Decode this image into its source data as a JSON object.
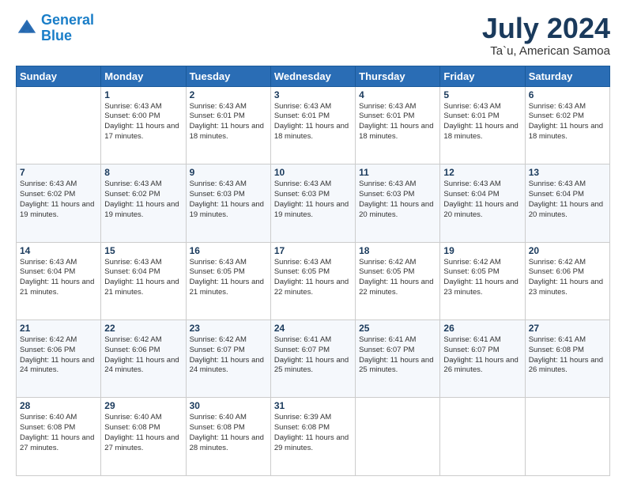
{
  "header": {
    "logo_line1": "General",
    "logo_line2": "Blue",
    "month_title": "July 2024",
    "location": "Ta`u, American Samoa"
  },
  "days_of_week": [
    "Sunday",
    "Monday",
    "Tuesday",
    "Wednesday",
    "Thursday",
    "Friday",
    "Saturday"
  ],
  "weeks": [
    [
      {
        "day": "",
        "sunrise": "",
        "sunset": "",
        "daylight": ""
      },
      {
        "day": "1",
        "sunrise": "6:43 AM",
        "sunset": "6:00 PM",
        "daylight": "11 hours and 17 minutes."
      },
      {
        "day": "2",
        "sunrise": "6:43 AM",
        "sunset": "6:01 PM",
        "daylight": "11 hours and 18 minutes."
      },
      {
        "day": "3",
        "sunrise": "6:43 AM",
        "sunset": "6:01 PM",
        "daylight": "11 hours and 18 minutes."
      },
      {
        "day": "4",
        "sunrise": "6:43 AM",
        "sunset": "6:01 PM",
        "daylight": "11 hours and 18 minutes."
      },
      {
        "day": "5",
        "sunrise": "6:43 AM",
        "sunset": "6:01 PM",
        "daylight": "11 hours and 18 minutes."
      },
      {
        "day": "6",
        "sunrise": "6:43 AM",
        "sunset": "6:02 PM",
        "daylight": "11 hours and 18 minutes."
      }
    ],
    [
      {
        "day": "7",
        "sunrise": "6:43 AM",
        "sunset": "6:02 PM",
        "daylight": "11 hours and 19 minutes."
      },
      {
        "day": "8",
        "sunrise": "6:43 AM",
        "sunset": "6:02 PM",
        "daylight": "11 hours and 19 minutes."
      },
      {
        "day": "9",
        "sunrise": "6:43 AM",
        "sunset": "6:03 PM",
        "daylight": "11 hours and 19 minutes."
      },
      {
        "day": "10",
        "sunrise": "6:43 AM",
        "sunset": "6:03 PM",
        "daylight": "11 hours and 19 minutes."
      },
      {
        "day": "11",
        "sunrise": "6:43 AM",
        "sunset": "6:03 PM",
        "daylight": "11 hours and 20 minutes."
      },
      {
        "day": "12",
        "sunrise": "6:43 AM",
        "sunset": "6:04 PM",
        "daylight": "11 hours and 20 minutes."
      },
      {
        "day": "13",
        "sunrise": "6:43 AM",
        "sunset": "6:04 PM",
        "daylight": "11 hours and 20 minutes."
      }
    ],
    [
      {
        "day": "14",
        "sunrise": "6:43 AM",
        "sunset": "6:04 PM",
        "daylight": "11 hours and 21 minutes."
      },
      {
        "day": "15",
        "sunrise": "6:43 AM",
        "sunset": "6:04 PM",
        "daylight": "11 hours and 21 minutes."
      },
      {
        "day": "16",
        "sunrise": "6:43 AM",
        "sunset": "6:05 PM",
        "daylight": "11 hours and 21 minutes."
      },
      {
        "day": "17",
        "sunrise": "6:43 AM",
        "sunset": "6:05 PM",
        "daylight": "11 hours and 22 minutes."
      },
      {
        "day": "18",
        "sunrise": "6:42 AM",
        "sunset": "6:05 PM",
        "daylight": "11 hours and 22 minutes."
      },
      {
        "day": "19",
        "sunrise": "6:42 AM",
        "sunset": "6:05 PM",
        "daylight": "11 hours and 23 minutes."
      },
      {
        "day": "20",
        "sunrise": "6:42 AM",
        "sunset": "6:06 PM",
        "daylight": "11 hours and 23 minutes."
      }
    ],
    [
      {
        "day": "21",
        "sunrise": "6:42 AM",
        "sunset": "6:06 PM",
        "daylight": "11 hours and 24 minutes."
      },
      {
        "day": "22",
        "sunrise": "6:42 AM",
        "sunset": "6:06 PM",
        "daylight": "11 hours and 24 minutes."
      },
      {
        "day": "23",
        "sunrise": "6:42 AM",
        "sunset": "6:07 PM",
        "daylight": "11 hours and 24 minutes."
      },
      {
        "day": "24",
        "sunrise": "6:41 AM",
        "sunset": "6:07 PM",
        "daylight": "11 hours and 25 minutes."
      },
      {
        "day": "25",
        "sunrise": "6:41 AM",
        "sunset": "6:07 PM",
        "daylight": "11 hours and 25 minutes."
      },
      {
        "day": "26",
        "sunrise": "6:41 AM",
        "sunset": "6:07 PM",
        "daylight": "11 hours and 26 minutes."
      },
      {
        "day": "27",
        "sunrise": "6:41 AM",
        "sunset": "6:08 PM",
        "daylight": "11 hours and 26 minutes."
      }
    ],
    [
      {
        "day": "28",
        "sunrise": "6:40 AM",
        "sunset": "6:08 PM",
        "daylight": "11 hours and 27 minutes."
      },
      {
        "day": "29",
        "sunrise": "6:40 AM",
        "sunset": "6:08 PM",
        "daylight": "11 hours and 27 minutes."
      },
      {
        "day": "30",
        "sunrise": "6:40 AM",
        "sunset": "6:08 PM",
        "daylight": "11 hours and 28 minutes."
      },
      {
        "day": "31",
        "sunrise": "6:39 AM",
        "sunset": "6:08 PM",
        "daylight": "11 hours and 29 minutes."
      },
      {
        "day": "",
        "sunrise": "",
        "sunset": "",
        "daylight": ""
      },
      {
        "day": "",
        "sunrise": "",
        "sunset": "",
        "daylight": ""
      },
      {
        "day": "",
        "sunrise": "",
        "sunset": "",
        "daylight": ""
      }
    ]
  ],
  "labels": {
    "sunrise_prefix": "Sunrise: ",
    "sunset_prefix": "Sunset: ",
    "daylight_prefix": "Daylight: "
  }
}
